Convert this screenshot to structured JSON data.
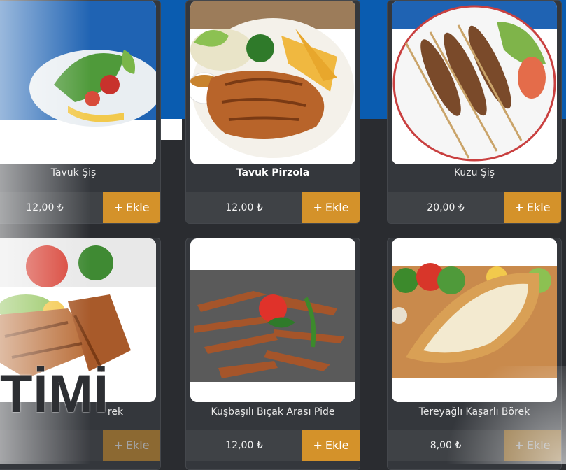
{
  "colors": {
    "accent": "#d4922a",
    "banner": "#0a5cb0",
    "card_bg": "#34373c"
  },
  "add_button": {
    "label": "Ekle",
    "icon": "plus-icon"
  },
  "products": [
    {
      "name": "Tavuk Şiş",
      "price": "12,00 ₺"
    },
    {
      "name": "Tavuk Pirzola",
      "price": "12,00 ₺"
    },
    {
      "name": "Kuzu Şiş",
      "price": "20,00 ₺"
    },
    {
      "name": "rek",
      "price": ""
    },
    {
      "name": "Kuşbaşılı Bıçak Arası Pide",
      "price": "12,00 ₺"
    },
    {
      "name": "Tereyağlı Kaşarlı Börek",
      "price": "8,00 ₺"
    }
  ],
  "promo_text": "TİMİ"
}
